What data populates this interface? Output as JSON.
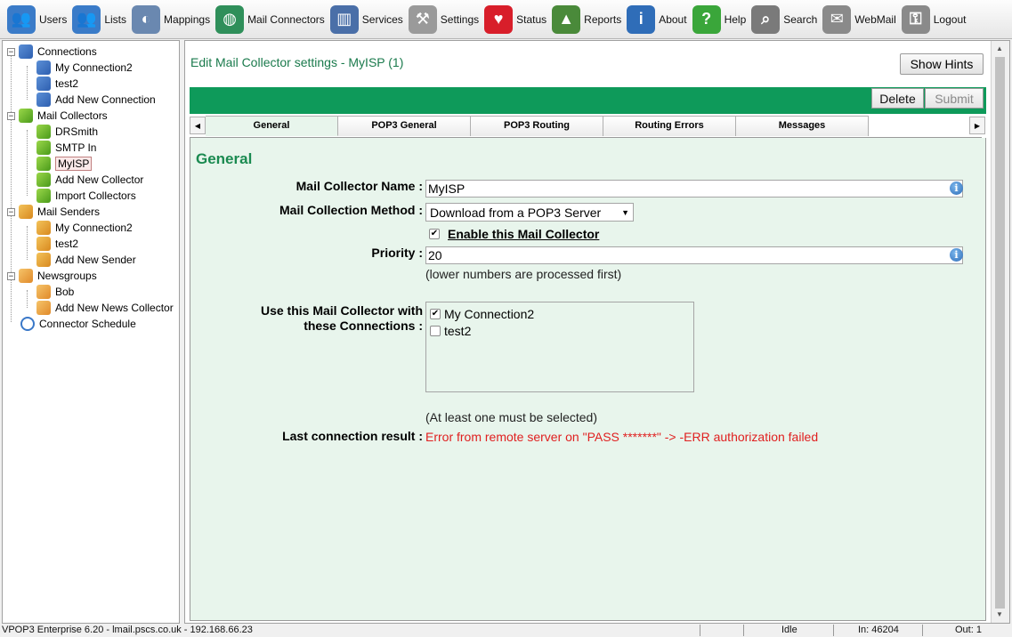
{
  "toolbar": {
    "items": [
      {
        "label": "Users",
        "icon": "users-icon",
        "color": "#3a7bc8"
      },
      {
        "label": "Lists",
        "icon": "lists-icon",
        "color": "#3a7bc8"
      },
      {
        "label": "Mappings",
        "icon": "mappings-icon",
        "color": "#6a88b0"
      },
      {
        "label": "Mail Connectors",
        "icon": "globe-mail-icon",
        "color": "#2f8f5a"
      },
      {
        "label": "Services",
        "icon": "server-icon",
        "color": "#4a6fa8"
      },
      {
        "label": "Settings",
        "icon": "wrench-icon",
        "color": "#9a9a9a"
      },
      {
        "label": "Status",
        "icon": "heart-icon",
        "color": "#d81e2a"
      },
      {
        "label": "Reports",
        "icon": "chart-icon",
        "color": "#4a8a3a"
      },
      {
        "label": "About",
        "icon": "info-icon",
        "color": "#2f6db8"
      },
      {
        "label": "Help",
        "icon": "help-icon",
        "color": "#3aa63a"
      },
      {
        "label": "Search",
        "icon": "magnifier-icon",
        "color": "#7a7a7a"
      },
      {
        "label": "WebMail",
        "icon": "webmail-icon",
        "color": "#8a8a8a"
      },
      {
        "label": "Logout",
        "icon": "padlock-icon",
        "color": "#8a8a8a"
      }
    ]
  },
  "tree": {
    "connections": "Connections",
    "my_connection2": "My Connection2",
    "test2": "test2",
    "add_new_connection": "Add New Connection",
    "mail_collectors": "Mail Collectors",
    "drsmith": "DRSmith",
    "smtp_in": "SMTP In",
    "myisp": "MyISP",
    "add_new_collector": "Add New Collector",
    "import_collectors": "Import Collectors",
    "mail_senders": "Mail Senders",
    "sender_my_connection2": "My Connection2",
    "sender_test2": "test2",
    "add_new_sender": "Add New Sender",
    "newsgroups": "Newsgroups",
    "bob": "Bob",
    "add_new_news_collector": "Add New News Collector",
    "connector_schedule": "Connector Schedule"
  },
  "main": {
    "title": "Edit Mail Collector settings - MyISP (1)",
    "show_hints": "Show Hints",
    "delete": "Delete",
    "submit": "Submit",
    "tabs": [
      "General",
      "POP3 General",
      "POP3 Routing",
      "Routing Errors",
      "Messages"
    ],
    "active_tab": "General",
    "section_title": "General",
    "collector_name_label": "Mail Collector Name :",
    "collector_name_value": "MyISP",
    "method_label": "Mail Collection Method :",
    "method_value": "Download from a POP3 Server",
    "enable_label": "Enable this Mail Collector",
    "enable_checked": true,
    "priority_label": "Priority :",
    "priority_value": "20",
    "priority_note": "(lower numbers are processed first)",
    "connections_label_line1": "Use this Mail Collector with",
    "connections_label_line2": "these Connections :",
    "connections": [
      {
        "name": "My Connection2",
        "checked": true
      },
      {
        "name": "test2",
        "checked": false
      }
    ],
    "connections_note": "(At least one must be selected)",
    "last_result_label": "Last connection result :",
    "last_result_value": "Error from remote server on \"PASS *******\" -> -ERR authorization failed",
    "error_color": "#e02020",
    "accent_color": "#0e9a5a"
  },
  "status_bar": {
    "product": "VPOP3 Enterprise 6.20 - lmail.pscs.co.uk - 192.168.66.23",
    "state": "Idle",
    "in": "In: 46204",
    "out": "Out: 1"
  }
}
